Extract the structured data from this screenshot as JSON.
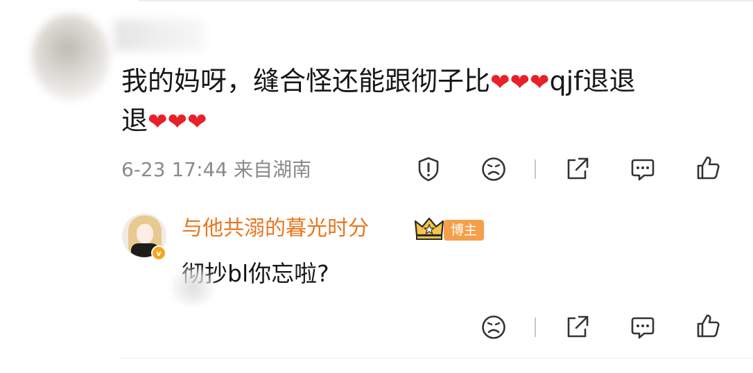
{
  "comment": {
    "text": "我的妈呀，缝合怪还能跟彻子比",
    "hearts_1": "❤❤❤",
    "text_after": "qjf退退",
    "text_line2": "退",
    "hearts_2": "❤❤❤",
    "timestamp": "6-23 17:44",
    "location": "来自湖南",
    "actions": [
      "report-icon",
      "dislike-face-icon",
      "share-icon",
      "comment-icon",
      "like-icon"
    ]
  },
  "reply": {
    "author_name": "与他共溺的暮光时分",
    "author_badge": "博主",
    "verified_mark": "v",
    "text": "彻抄bl你忘啦?",
    "actions": [
      "dislike-face-icon",
      "share-icon",
      "comment-icon",
      "like-icon"
    ]
  },
  "colors": {
    "heart": "#e8202a",
    "reply_name": "#e8761e",
    "badge_bg": "#f4a04a",
    "meta_text": "#8a8a8a"
  }
}
